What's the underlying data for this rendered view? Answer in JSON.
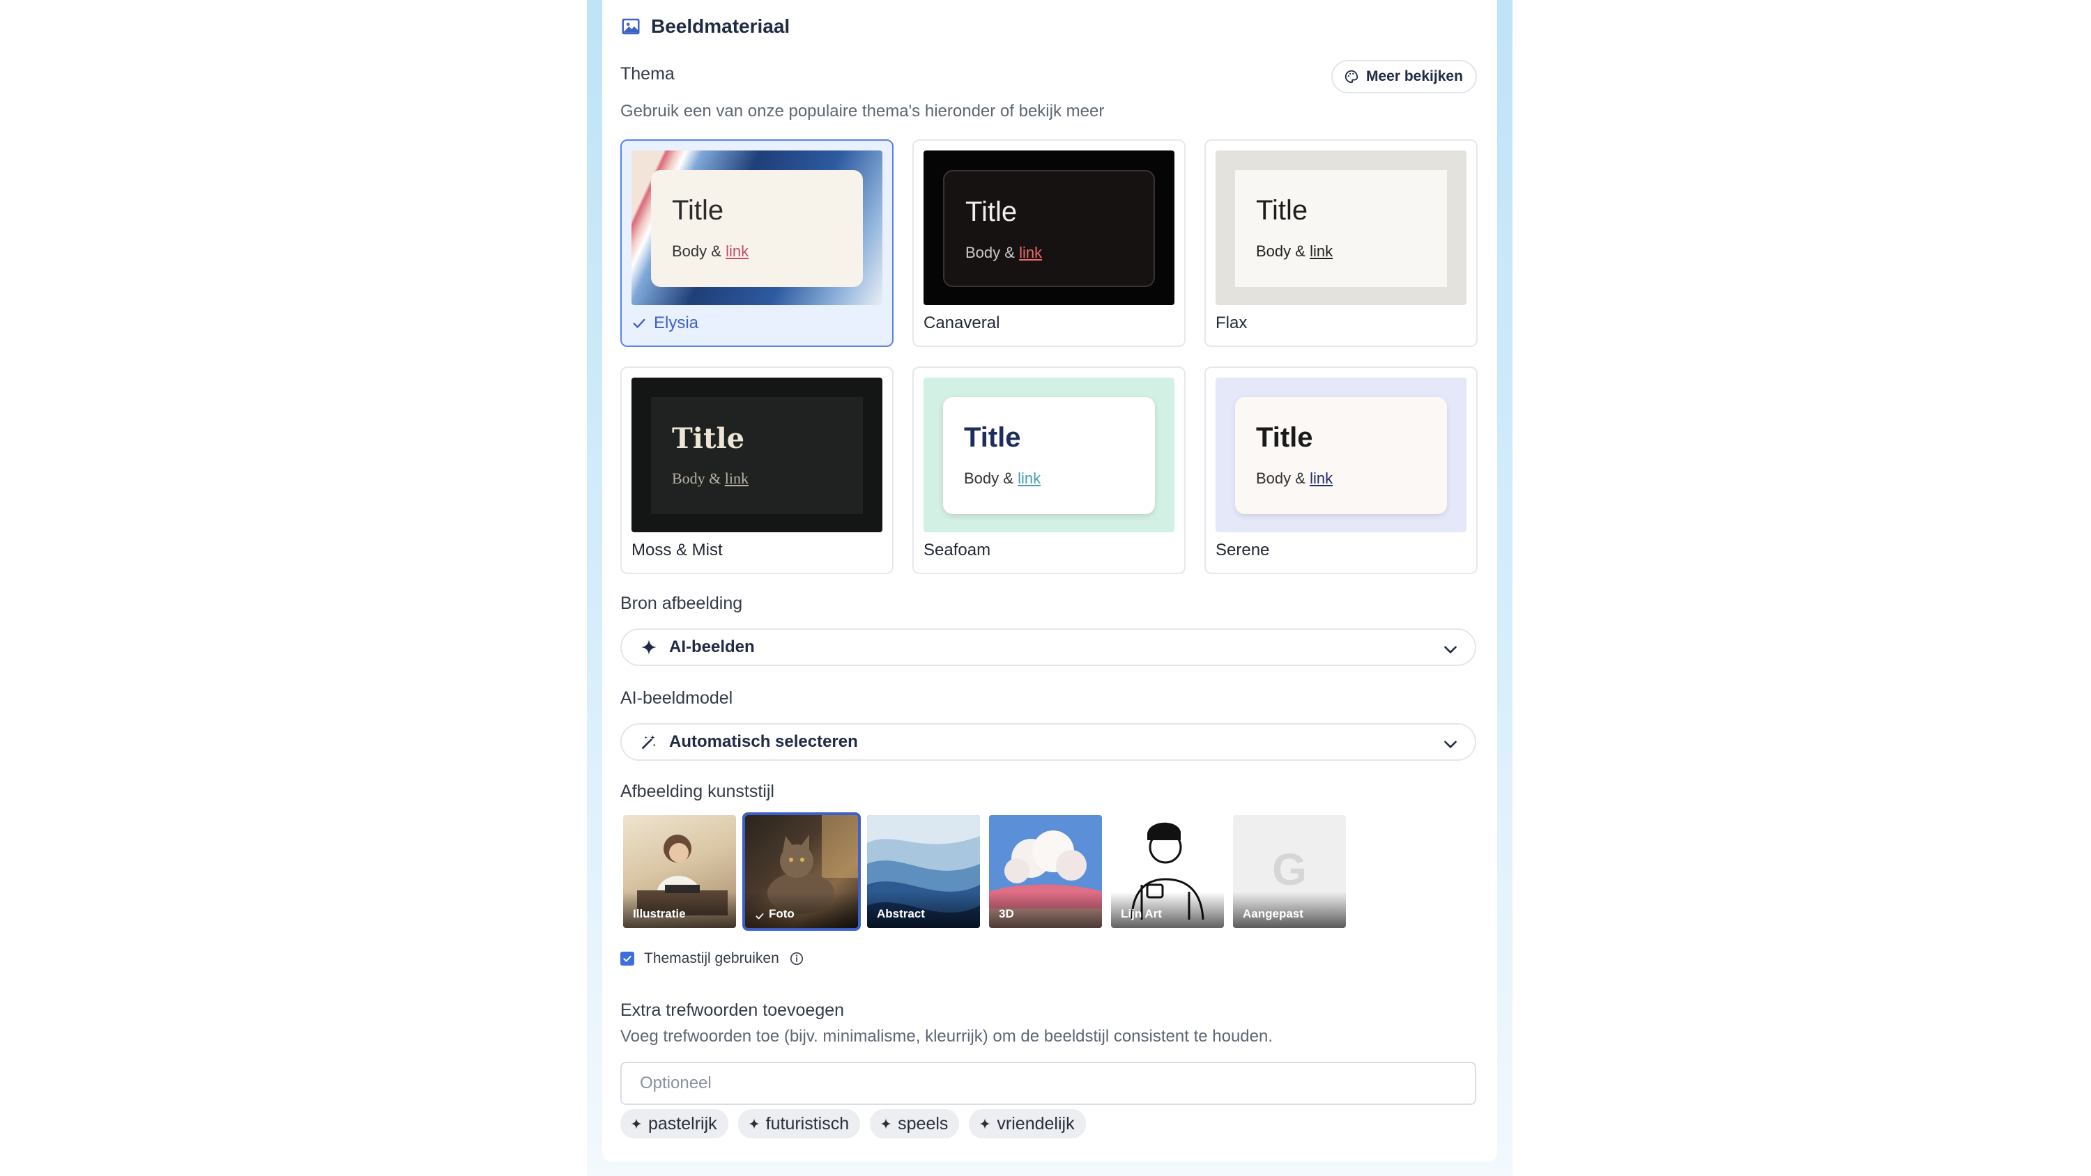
{
  "section": {
    "title": "Beeldmateriaal",
    "icon": "image-icon"
  },
  "theme": {
    "label": "Thema",
    "more_button": "Meer bekijken",
    "description": "Gebruik een van onze populaire thema's hieronder of bekijk meer",
    "selected": "Elysia",
    "items": [
      {
        "name": "Elysia",
        "title": "Title",
        "body": "Body &",
        "link": "link",
        "selected": true
      },
      {
        "name": "Canaveral",
        "title": "Title",
        "body": "Body &",
        "link": "link",
        "selected": false
      },
      {
        "name": "Flax",
        "title": "Title",
        "body": "Body &",
        "link": "link",
        "selected": false
      },
      {
        "name": "Moss & Mist",
        "title": "Title",
        "body": "Body &",
        "link": "link",
        "selected": false
      },
      {
        "name": "Seafoam",
        "title": "Title",
        "body": "Body &",
        "link": "link",
        "selected": false
      },
      {
        "name": "Serene",
        "title": "Title",
        "body": "Body &",
        "link": "link",
        "selected": false
      }
    ]
  },
  "image_source": {
    "label": "Bron afbeelding",
    "value": "AI-beelden",
    "icon": "sparkle-icon"
  },
  "image_model": {
    "label": "AI-beeldmodel",
    "value": "Automatisch selecteren",
    "icon": "magic-wand-icon"
  },
  "art_style": {
    "label": "Afbeelding kunststijl",
    "selected": "Foto",
    "items": [
      {
        "name": "Illustratie"
      },
      {
        "name": "Foto"
      },
      {
        "name": "Abstract"
      },
      {
        "name": "3D"
      },
      {
        "name": "Lijn Art"
      },
      {
        "name": "Aangepast"
      }
    ]
  },
  "theme_style": {
    "label": "Themastijl gebruiken",
    "checked": true
  },
  "keywords": {
    "label": "Extra trefwoorden toevoegen",
    "description": "Voeg trefwoorden toe (bijv. minimalisme, kleurrijk) om de beeldstijl consistent te houden.",
    "placeholder": "Optioneel",
    "suggestions": [
      "pastelrijk",
      "futuristisch",
      "speels",
      "vriendelijk"
    ]
  },
  "colors": {
    "accent": "#3d62c6",
    "selected_bg": "#e9f0fe",
    "checkbox": "#3d6ee0"
  }
}
